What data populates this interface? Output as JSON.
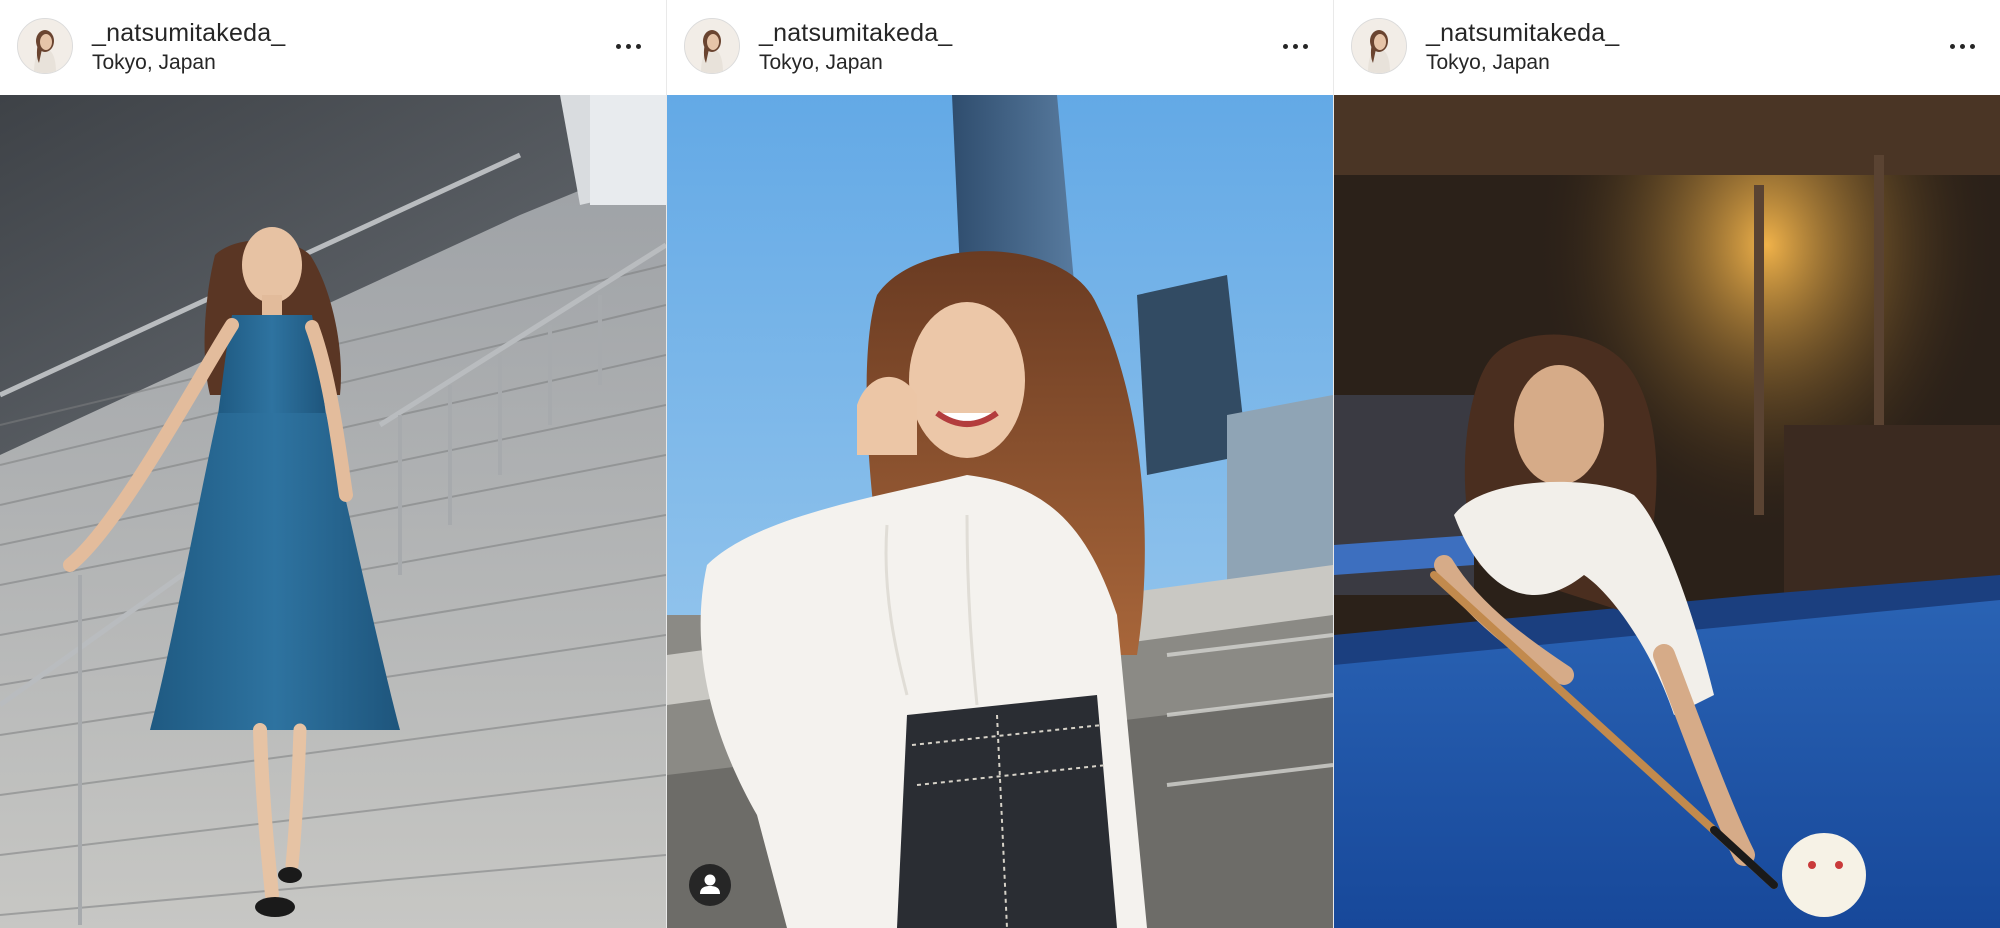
{
  "posts": [
    {
      "username": "_natsumitakeda_",
      "location": "Tokyo, Japan"
    },
    {
      "username": "_natsumitakeda_",
      "location": "Tokyo, Japan"
    },
    {
      "username": "_natsumitakeda_",
      "location": "Tokyo, Japan"
    }
  ],
  "icons": {
    "more": "more-horizontal-icon",
    "tag": "user-tag-icon"
  },
  "colors": {
    "text": "#262626",
    "pool_felt": "#1d55a8",
    "sky": "#7fb8e8",
    "dress": "#2c6a95"
  }
}
